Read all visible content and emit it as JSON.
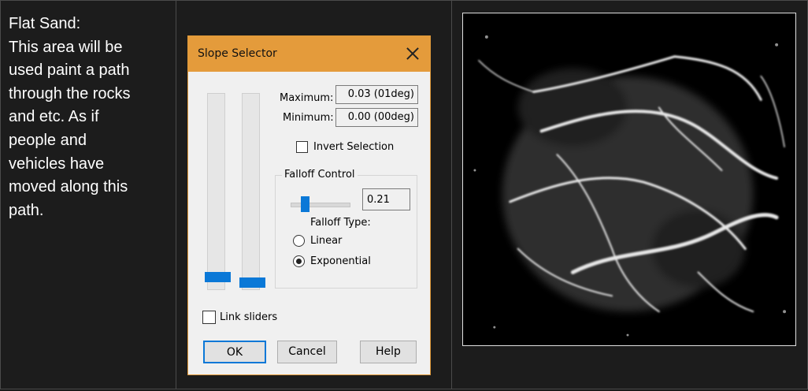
{
  "description": {
    "heading": "Flat Sand:",
    "body": "This area will be\nused paint a path\nthrough the rocks\nand etc. As if\npeople and\nvehicles have\nmoved along this\npath."
  },
  "dialog": {
    "title": "Slope Selector",
    "maximum_label": "Maximum:",
    "maximum_value": "0.03 (01deg)",
    "minimum_label": "Minimum:",
    "minimum_value": "0.00 (00deg)",
    "invert_label": "Invert Selection",
    "invert_checked": false,
    "falloff_group": "Falloff Control",
    "falloff_value": "0.21",
    "falloff_type_label": "Falloff Type:",
    "linear_label": "Linear",
    "exponential_label": "Exponential",
    "falloff_type_selected": "Exponential",
    "link_label": "Link sliders",
    "link_checked": false,
    "ok_label": "OK",
    "cancel_label": "Cancel",
    "help_label": "Help"
  }
}
